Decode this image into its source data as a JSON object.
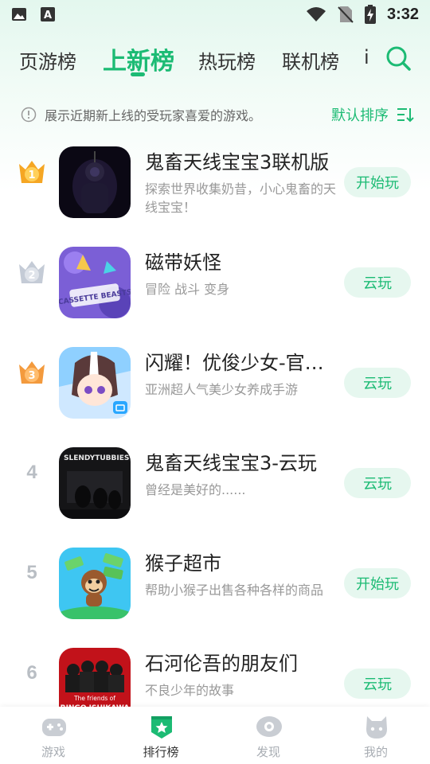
{
  "status_bar": {
    "time": "3:32",
    "left_icons": [
      "gallery-icon",
      "text-a-icon"
    ],
    "right_icons": [
      "wifi-icon",
      "no-sim-icon",
      "battery-charging-icon"
    ]
  },
  "tabs": [
    {
      "label": "页游榜",
      "active": false
    },
    {
      "label": "上新榜",
      "active": true
    },
    {
      "label": "热玩榜",
      "active": false
    },
    {
      "label": "联机榜",
      "active": false
    },
    {
      "label": "i",
      "active": false
    }
  ],
  "search_icon": "search-icon",
  "hint": {
    "icon": "info-icon",
    "text": "展示近期新上线的受玩家喜爱的游戏。",
    "sort_label": "默认排序",
    "sort_icon": "sort-icon"
  },
  "games": [
    {
      "rank": "1",
      "rank_badge": "gold-crown",
      "title": "鬼畜天线宝宝3联机版",
      "desc": "探索世界收集奶昔，小心鬼畜的天线宝宝！",
      "button": "开始玩"
    },
    {
      "rank": "2",
      "rank_badge": "silver-crown",
      "title": "磁带妖怪",
      "desc": "冒险 战斗 变身",
      "button": "云玩",
      "cover_text": "CASSETTE BEASTS"
    },
    {
      "rank": "3",
      "rank_badge": "bronze-crown",
      "title": "闪耀！优俊少女-官服...",
      "desc": "亚洲超人气美少女养成手游",
      "button": "云玩"
    },
    {
      "rank": "4",
      "rank_badge": "",
      "title": "鬼畜天线宝宝3-云玩",
      "desc": "曾经是美好的......",
      "button": "云玩",
      "cover_text": "SLENDYTUBBIES III"
    },
    {
      "rank": "5",
      "rank_badge": "",
      "title": "猴子超市",
      "desc": "帮助小猴子出售各种各样的商品",
      "button": "开始玩"
    },
    {
      "rank": "6",
      "rank_badge": "",
      "title": "石河伦吾的朋友们",
      "desc": "不良少年的故事",
      "button": "云玩",
      "cover_text_1": "The friends of",
      "cover_text_2": "RINGO ISHIKAWA"
    }
  ],
  "bottom_nav": [
    {
      "label": "游戏",
      "icon": "gamepad-icon",
      "active": false
    },
    {
      "label": "排行榜",
      "icon": "ranking-icon",
      "active": true
    },
    {
      "label": "发现",
      "icon": "discover-icon",
      "active": false
    },
    {
      "label": "我的",
      "icon": "profile-icon",
      "active": false
    }
  ],
  "colors": {
    "accent": "#1cbb74",
    "button_bg": "#e6f7ef",
    "muted": "#999999",
    "gold": "#f5a623",
    "silver": "#c4cbd6",
    "bronze": "#f39a3d"
  }
}
